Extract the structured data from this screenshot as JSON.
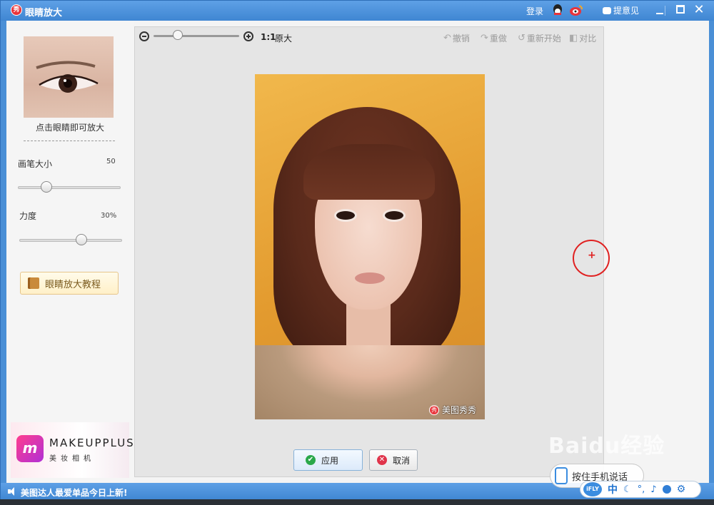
{
  "window": {
    "title": "眼睛放大",
    "logo_glyph": "秀",
    "login": "登录",
    "feedback": "提意见"
  },
  "left_panel": {
    "eye_hint": "点击眼睛即可放大",
    "brush_label": "画笔大小",
    "brush_value": "50",
    "strength_label": "力度",
    "strength_value": "30%",
    "tutorial_button": "眼睛放大教程"
  },
  "sliders": {
    "brush_level": 0.25,
    "strength_level": 0.62,
    "zoom_level": 0.25
  },
  "ad": {
    "logo_glyph": "m",
    "brand": "MAKEUPPLUS",
    "subtitle": "美妆相机"
  },
  "toolbar": {
    "zoom_ratio": "1:1",
    "zoom_label": "原大",
    "undo": "撤销",
    "redo": "重做",
    "restart": "重新开始",
    "compare": "对比"
  },
  "photo": {
    "watermark_glyph": "秀",
    "watermark": "美图秀秀"
  },
  "actions": {
    "apply": "应用",
    "cancel": "取消"
  },
  "status": {
    "text": "美图达人最爱单品今日上新!"
  },
  "overlay": {
    "baidu": "Baidu经验",
    "voice_hint": "按住手机说话",
    "ime_brand": "iFLY",
    "ime_mode": "中"
  },
  "colors": {
    "titlebar": "#4a8fd6",
    "accent_red": "#e8343a",
    "apply_green": "#2aa84a",
    "cancel_red": "#e0344a"
  }
}
